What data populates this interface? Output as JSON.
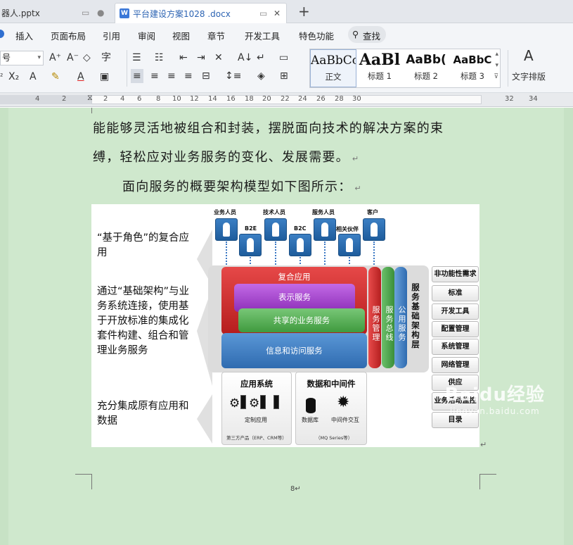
{
  "tabs": [
    {
      "label": "器人.pptx"
    },
    {
      "label": "平台建设方案1028 .docx",
      "icon": "W"
    }
  ],
  "menu": [
    "插入",
    "页面布局",
    "引用",
    "审阅",
    "视图",
    "章节",
    "开发工具",
    "特色功能",
    "查找"
  ],
  "ribbon": {
    "font_size_value": "号",
    "styles": [
      {
        "preview": "AaBbCcDd",
        "name": "正文"
      },
      {
        "preview": "AaBl",
        "name": "标题 1"
      },
      {
        "preview": "AaBb(",
        "name": "标题 2"
      },
      {
        "preview": "AaBbC",
        "name": "标题 3"
      }
    ],
    "text_layout_label": "文字排版",
    "ribbon_text_icon": "A"
  },
  "ruler": [
    "4",
    "2",
    "2",
    "4",
    "6",
    "8",
    "10",
    "12",
    "14",
    "16",
    "18",
    "20",
    "22",
    "24",
    "26",
    "28",
    "30",
    "32",
    "34"
  ],
  "document": {
    "lines": [
      "能能够灵活地被组合和封装，摆脱面向技术的解决方案的束",
      "缚，轻松应对业务服务的变化、发展需要。",
      "面向服务的概要架构模型如下图所示："
    ],
    "para_mark": "↵",
    "page_number": "8↵"
  },
  "figure": {
    "left_labels": [
      "“基于角色”的复合应用",
      "通过“基础架构”与业务系统连接，使用基于开放标准的集成化套件构建、组合和管理业务服务",
      "充分集成原有应用和数据"
    ],
    "people": [
      "业务人员",
      "B2E",
      "技术人员",
      "B2C",
      "服务人员",
      "相关伙伴",
      "客户"
    ],
    "layers": {
      "composite": "复合应用",
      "presentation": "表示服务",
      "shared": "共享的业务服务",
      "info": "信息和访问服务"
    },
    "bars": [
      "服务管理",
      "服务总线",
      "公用服务"
    ],
    "infra_title": "服务基础架构层",
    "app_system": {
      "title": "应用系统",
      "sub": "定制应用",
      "foot": "第三方产品（ERP、CRM等）"
    },
    "data_middleware": {
      "title": "数据和中间件",
      "sub1": "数据库",
      "sub2": "中间件交互",
      "foot": "（MQ Series等）"
    },
    "right_items": [
      "非功能性需求",
      "标准",
      "开发工具",
      "配置管理",
      "系统管理",
      "网络管理",
      "供应",
      "业务活动监控",
      "目录"
    ]
  },
  "watermark": {
    "big": "Baidu经验",
    "small": "jingyan.baidu.com"
  },
  "colors": {
    "page_bg": "#cfe8cd",
    "accent_blue": "#2f6fd0"
  }
}
